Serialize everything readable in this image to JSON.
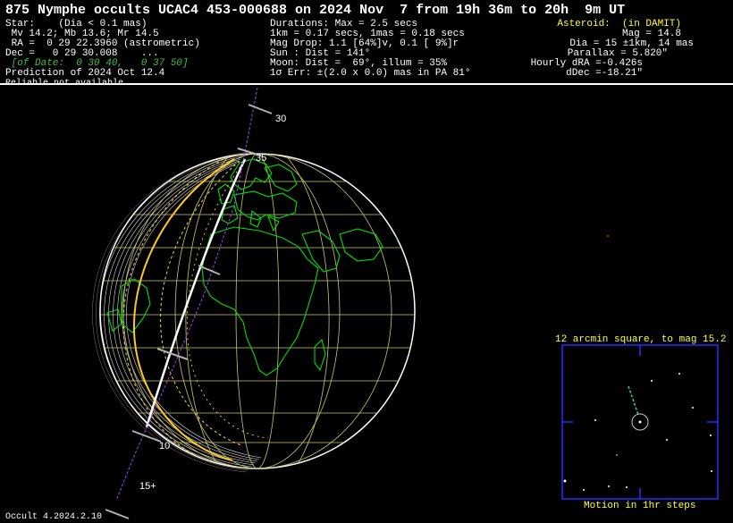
{
  "title": "875 Nymphe occults UCAC4 453-000688 on 2024 Nov  7 from 19h 36m to 20h  9m UT",
  "left_col": [
    {
      "text": "Star:    (Dia < 0.1 mas)",
      "style": "w"
    },
    {
      "text": " Mv 14.2; Mb 13.6; Mr 14.5",
      "style": "w"
    },
    {
      "text": " RA =  0 29 22.3960 (astrometric)",
      "style": "w"
    },
    {
      "text": "Dec =   0 29 30.008    ...",
      "style": "w"
    },
    {
      "text": " [of Date:  0 30 40,   0 37 50]",
      "style": "g"
    },
    {
      "text": "Prediction of 2024 Oct 12.4",
      "style": "w"
    },
    {
      "text": "Reliable not available",
      "style": "w"
    }
  ],
  "mid_col": [
    "Durations: Max = 2.5 secs",
    "1km = 0.17 secs, 1mas = 0.18 secs",
    "Mag Drop: 1.1 [64%]v, 0.1 [ 9%]r",
    "Sun : Dist = 141°",
    "Moon: Dist =  69°, illum = 35%",
    "1σ Err: ±(2.0 x 0.0) mas in PA 81°"
  ],
  "right_col": [
    {
      "text": "Asteroid:  (in DAMIT)",
      "style": "y"
    },
    {
      "text": "Mag = 14.8",
      "style": "w"
    },
    {
      "text": "Dia = 15 ±1km, 14 mas",
      "style": "w"
    },
    {
      "text": "Parallax = 5.820\"",
      "style": "w"
    },
    {
      "text": "Hourly dRA =-0.426s",
      "style": "w"
    },
    {
      "text": "dDec =-18.21\"",
      "style": "w"
    }
  ],
  "track_ticks": [
    "30",
    "35",
    "10",
    "15+"
  ],
  "inset": {
    "title": "12 arcmin square, to mag 15.2",
    "caption": "Motion in 1hr steps"
  },
  "footer": "Occult 4.2024.2.10",
  "colors": {
    "background": "#000000",
    "land": "#00e000",
    "grid": "#c8c86e",
    "track_center": "#ffffff",
    "limit_line": "#ffc81e",
    "sigma_line": "#ffd23c",
    "time_axis": "#a040ff",
    "inset_frame": "#2a2aff",
    "header_accent": "#ffff2a",
    "header_green": "#41c041"
  },
  "icons": [
    "earth-globe",
    "star-field",
    "target-circle"
  ]
}
